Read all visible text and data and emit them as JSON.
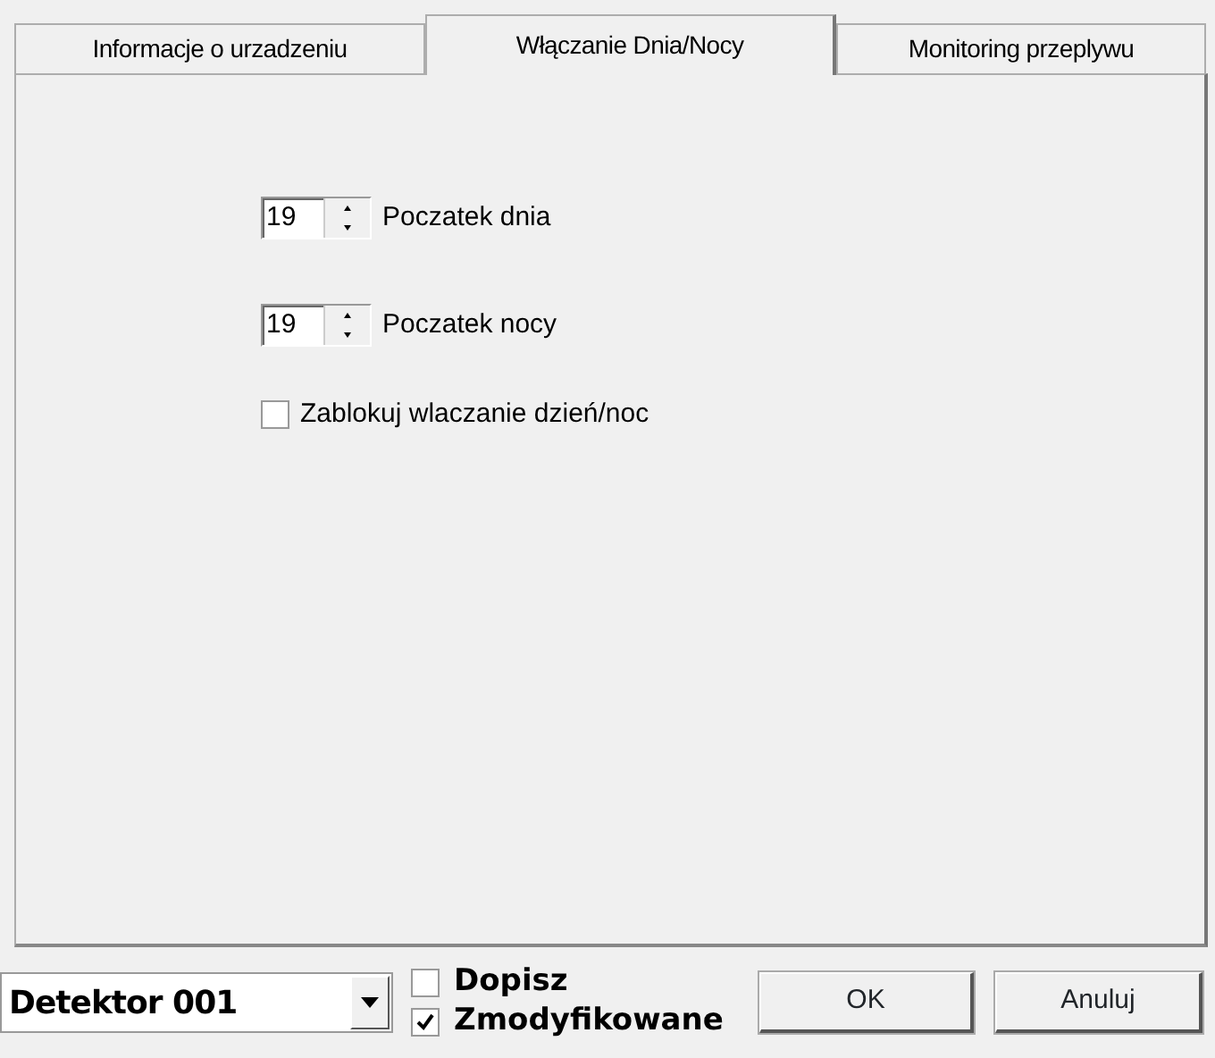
{
  "tabs": [
    {
      "label": "Informacje o urzadzeniu",
      "selected": false
    },
    {
      "label": "Włączanie Dnia/Nocy",
      "selected": true
    },
    {
      "label": "Monitoring przeplywu",
      "selected": false
    }
  ],
  "spinners": [
    {
      "value": "19",
      "label": "Poczatek dnia"
    },
    {
      "value": "19",
      "label": "Poczatek nocy"
    }
  ],
  "lock_checkbox": {
    "label": "Zablokuj wlaczanie dzień/noc",
    "checked": false
  },
  "device_combo": {
    "value": "Detektor 001"
  },
  "options": [
    {
      "label": "Dopisz",
      "checked": false
    },
    {
      "label": "Zmodyfikowane",
      "checked": true
    }
  ],
  "buttons": [
    "OK",
    "Anuluj"
  ]
}
